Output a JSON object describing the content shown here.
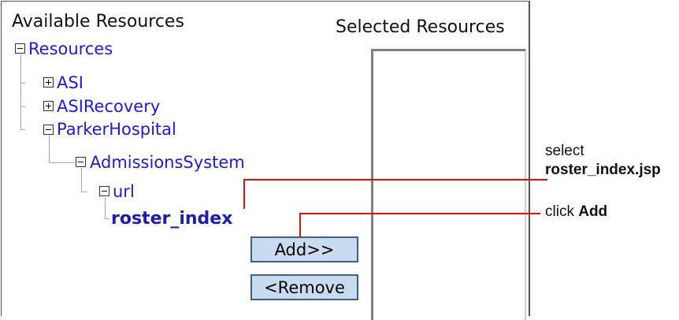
{
  "available_title": "Available Resources",
  "selected_title": "Selected Resources",
  "tree": {
    "root": "Resources",
    "asi": "ASI",
    "asi_recovery": "ASIRecovery",
    "parker_hospital": "ParkerHospital",
    "admissions_system": "AdmissionsSystem",
    "url": "url",
    "roster_index": "roster_index"
  },
  "buttons": {
    "add": "Add>>",
    "remove": "<Remove"
  },
  "callouts": {
    "select_line1": "select",
    "select_line2": "roster_index.jsp",
    "click_prefix": "click ",
    "click_bold": "Add"
  },
  "colors": {
    "tree_text": "#1a1ae0",
    "annotation_line": "#e01010",
    "button_fill": "#c9dbf0"
  }
}
